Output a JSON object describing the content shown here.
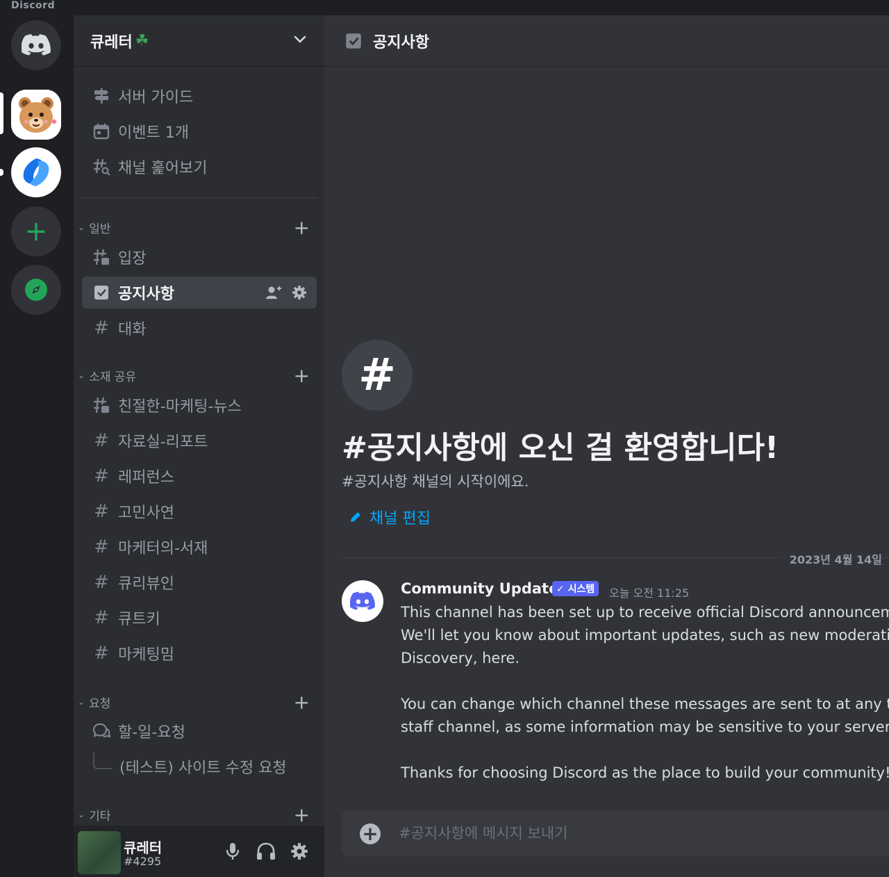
{
  "app": {
    "title": "Discord"
  },
  "guild": {
    "name": "큐레터",
    "emoji": "☘"
  },
  "nav_items": [
    {
      "label": "서버 가이드",
      "icon": "signpost-icon"
    },
    {
      "label": "이벤트 1개",
      "icon": "calendar-icon"
    },
    {
      "label": "채널 훑어보기",
      "icon": "channel-browse-icon"
    }
  ],
  "categories": {
    "general": {
      "label": "일반",
      "channels": [
        {
          "label": "입장",
          "icon": "rules-channel-icon"
        },
        {
          "label": "공지사항",
          "icon": "announcement-channel-icon",
          "active": true
        },
        {
          "label": "대화",
          "icon": "hash-icon"
        }
      ]
    },
    "share": {
      "label": "소재 공유",
      "channels": [
        {
          "label": "친절한-마케팅-뉴스",
          "icon": "rules-channel-icon"
        },
        {
          "label": "자료실-리포트",
          "icon": "hash-icon"
        },
        {
          "label": "레퍼런스",
          "icon": "hash-icon"
        },
        {
          "label": "고민사연",
          "icon": "hash-icon"
        },
        {
          "label": "마케터의-서재",
          "icon": "hash-icon"
        },
        {
          "label": "큐리뷰인",
          "icon": "hash-icon"
        },
        {
          "label": "큐트키",
          "icon": "hash-icon"
        },
        {
          "label": "마케팅밈",
          "icon": "hash-icon"
        }
      ]
    },
    "request": {
      "label": "요청",
      "channels": [
        {
          "label": "할-일-요청",
          "icon": "forum-icon"
        }
      ],
      "threads": [
        {
          "label": "(테스트) 사이트 수정 요청"
        }
      ]
    },
    "etc": {
      "label": "기타"
    }
  },
  "user": {
    "name": "큐레터",
    "tag": "#4295"
  },
  "channel": {
    "name": "공지사항",
    "welcome_title": "#공지사항에 오신 걸 환영합니다!",
    "welcome_subtitle": "#공지사항 채널의 시작이에요.",
    "edit_label": "채널 편집"
  },
  "date_divider": "2023년 4월 14일",
  "message": {
    "author": "Community Updates",
    "badge": "✓ 시스템",
    "time": "오늘 오전 11:25",
    "lines": [
      "This channel has been set up to receive official Discord announcemer",
      "We'll let you know about important updates, such as new moderation",
      "Discovery, here.",
      "You can change which channel these messages are sent to at any time",
      "staff channel, as some information may be sensitive to your server.",
      "Thanks for choosing Discord as the place to build your community!"
    ]
  },
  "composer": {
    "placeholder": "#공지사항에 메시지 보내기"
  },
  "colors": {
    "blurple": "#5865f2",
    "link": "#00a8fc",
    "green": "#23a559",
    "active_row": "#404249"
  }
}
